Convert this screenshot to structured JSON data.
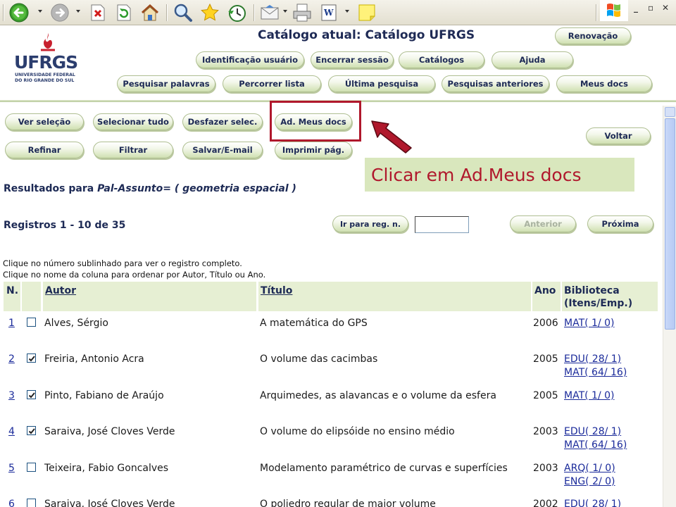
{
  "window": {
    "controls": [
      "_",
      "▫",
      "✕"
    ]
  },
  "toolbar": {
    "icons": [
      "back-icon",
      "forward-icon",
      "stop-icon",
      "refresh-icon",
      "home-icon",
      "search-icon",
      "favorites-icon",
      "history-icon",
      "mail-icon",
      "print-icon",
      "word-icon",
      "notes-icon"
    ]
  },
  "header": {
    "logo_word": "UFRGS",
    "logo_sub_1": "UNIVERSIDADE FEDERAL",
    "logo_sub_2": "DO RIO GRANDE DO SUL",
    "catalog_title": "Catálogo atual: Catálogo UFRGS",
    "renew_label": "Renovação",
    "nav_row1": [
      "Identificação usuário",
      "Encerrar sessão",
      "Catálogos",
      "Ajuda"
    ],
    "nav_row2": [
      "Pesquisar palavras",
      "Percorrer lista",
      "Última pesquisa",
      "Pesquisas anteriores",
      "Meus docs"
    ]
  },
  "actions": {
    "row1": [
      "Ver seleção",
      "Selecionar tudo",
      "Desfazer selec.",
      "Ad. Meus docs"
    ],
    "row2": [
      "Refinar",
      "Filtrar",
      "Salvar/E-mail",
      "Imprimir pág."
    ],
    "back_label": "Voltar"
  },
  "callout": {
    "text": "Clicar em Ad.Meus docs",
    "color": "#b0182c",
    "background": "#d9e7bd"
  },
  "results": {
    "prefix": "Resultados para ",
    "query": "Pal-Assunto= ( geometria espacial )",
    "records": "Registros 1 - 10 de 35",
    "goto_label": "Ir para reg. n.",
    "goto_value": "",
    "prev_label": "Anterior",
    "next_label": "Próxima",
    "hint_1": "Clique no número sublinhado para ver o registro completo.",
    "hint_2": "Clique no nome da coluna para ordenar por Autor, Título ou Ano."
  },
  "table": {
    "headers": {
      "num": "N.",
      "author": "Autor",
      "title": "Título",
      "year": "Ano",
      "library_1": "Biblioteca",
      "library_2": "(Itens/Emp.)"
    },
    "rows": [
      {
        "num": "1",
        "checked": false,
        "author": "Alves, Sérgio",
        "title": "A matemática do GPS",
        "year": "2006",
        "lib1": "MAT( 1/ 0)",
        "lib2": ""
      },
      {
        "num": "2",
        "checked": true,
        "author": "Freiria, Antonio Acra",
        "title": "O volume das cacimbas",
        "year": "2005",
        "lib1": "EDU( 28/ 1)",
        "lib2": "MAT( 64/ 16)"
      },
      {
        "num": "3",
        "checked": true,
        "author": "Pinto, Fabiano de Araújo",
        "title": "Arquimedes, as alavancas e o volume da esfera",
        "year": "2005",
        "lib1": "MAT( 1/ 0)",
        "lib2": ""
      },
      {
        "num": "4",
        "checked": true,
        "author": "Saraiva, José Cloves Verde",
        "title": "O volume do elipsóide no ensino médio",
        "year": "2003",
        "lib1": "EDU( 28/ 1)",
        "lib2": "MAT( 64/ 16)"
      },
      {
        "num": "5",
        "checked": false,
        "author": "Teixeira, Fabio Goncalves",
        "title": "Modelamento paramétrico de curvas e superfícies",
        "year": "2003",
        "lib1": "ARQ( 1/ 0)",
        "lib2": "ENG( 2/ 0)"
      },
      {
        "num": "6",
        "checked": false,
        "author": "Saraiva, José Cloves Verde",
        "title": "O poliedro regular de maior volume",
        "year": "2002",
        "lib1": "EDU( 28/ 1)",
        "lib2": ""
      }
    ]
  }
}
